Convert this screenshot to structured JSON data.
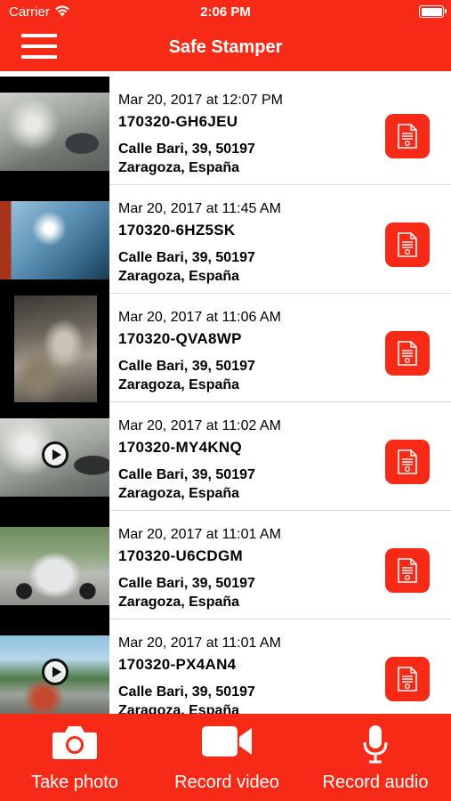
{
  "status_bar": {
    "carrier": "Carrier",
    "time": "2:06 PM"
  },
  "nav": {
    "title": "Safe Stamper",
    "menu_icon": "hamburger-menu-icon"
  },
  "colors": {
    "accent": "#f72a17",
    "text": "#000000",
    "divider": "#d9d9d9"
  },
  "records": [
    {
      "date": "Mar 20, 2017 at 12:07 PM",
      "code": "170320-GH6JEU",
      "address_line1": "Calle Bari, 39, 50197",
      "address_line2": "Zaragoza, España",
      "media": "photo"
    },
    {
      "date": "Mar 20, 2017 at 11:45 AM",
      "code": "170320-6HZ5SK",
      "address_line1": "Calle Bari, 39, 50197",
      "address_line2": "Zaragoza, España",
      "media": "photo"
    },
    {
      "date": "Mar 20, 2017 at 11:06 AM",
      "code": "170320-QVA8WP",
      "address_line1": "Calle Bari, 39, 50197",
      "address_line2": "Zaragoza, España",
      "media": "photo"
    },
    {
      "date": "Mar 20, 2017 at 11:02 AM",
      "code": "170320-MY4KNQ",
      "address_line1": "Calle Bari, 39, 50197",
      "address_line2": "Zaragoza, España",
      "media": "video"
    },
    {
      "date": "Mar 20, 2017 at 11:01 AM",
      "code": "170320-U6CDGM",
      "address_line1": "Calle Bari, 39, 50197",
      "address_line2": "Zaragoza, España",
      "media": "photo"
    },
    {
      "date": "Mar 20, 2017 at 11:01 AM",
      "code": "170320-PX4AN4",
      "address_line1": "Calle Bari, 39, 50197",
      "address_line2": "Zaragoza, España",
      "media": "video"
    }
  ],
  "toolbar": {
    "take_photo": "Take photo",
    "record_video": "Record video",
    "record_audio": "Record audio"
  }
}
